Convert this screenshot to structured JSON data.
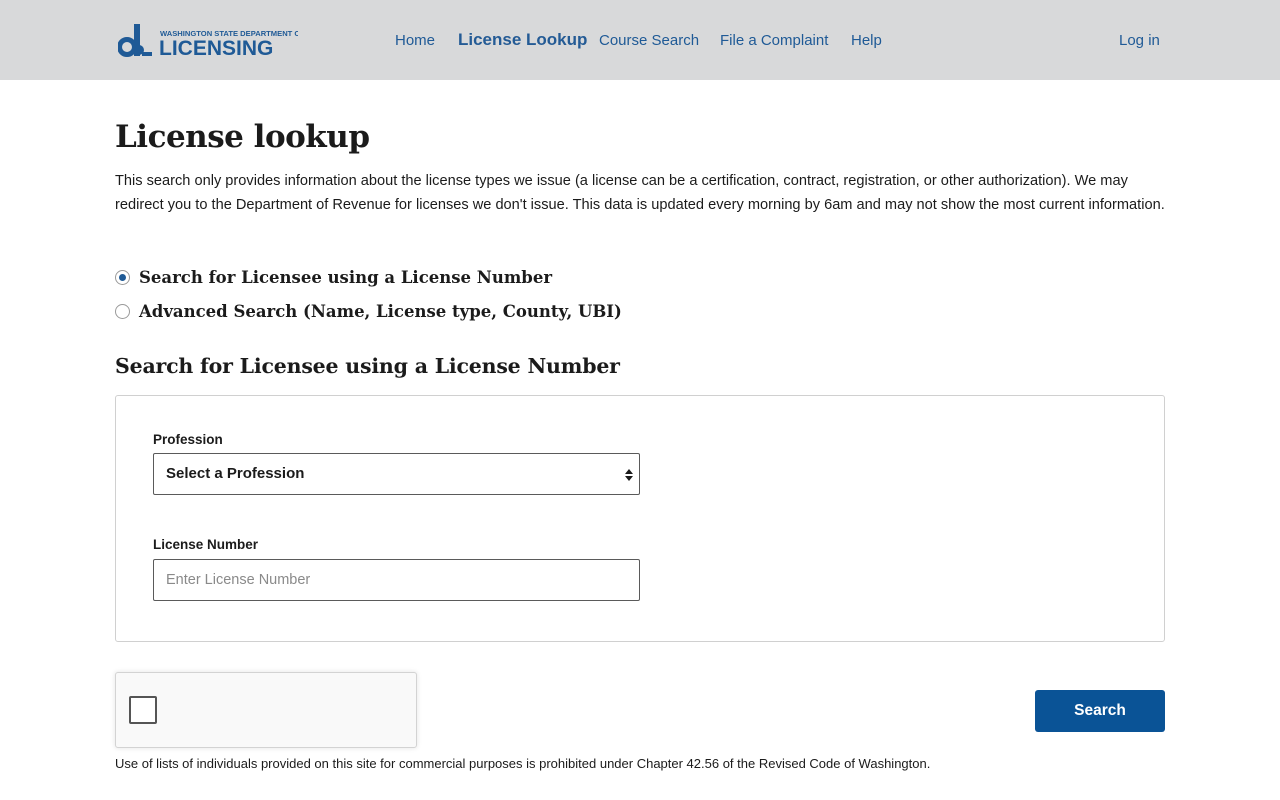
{
  "header": {
    "logo_top_text": "WASHINGTON STATE DEPARTMENT OF",
    "logo_main_text": "LICENSING",
    "nav": [
      "Home",
      "License Lookup",
      "Course Search",
      "File a Complaint",
      "Help"
    ],
    "active_nav": "License Lookup",
    "login": "Log in"
  },
  "page": {
    "title": "License lookup",
    "intro": "This search only provides information about the license types we issue (a license can be a certification, contract, registration, or other authorization). We may redirect you to the Department of Revenue for licenses we don't issue. This data is updated every morning by 6am and may not show the most current information."
  },
  "search_mode": {
    "options": [
      {
        "label": "Search for Licensee using a License Number",
        "checked": true
      },
      {
        "label": "Advanced Search (Name, License type, County, UBI)",
        "checked": false
      }
    ]
  },
  "form": {
    "heading": "Search for Licensee using a License Number",
    "profession_label": "Profession",
    "profession_selected": "Select a Profession",
    "license_number_label": "License Number",
    "license_number_value": "",
    "license_number_placeholder": "Enter License Number",
    "search_button": "Search"
  },
  "captcha": {
    "checked": false
  },
  "footer": {
    "note": "Use of lists of individuals provided on this site for commercial purposes is prohibited under Chapter 42.56 of the Revised Code of Washington."
  },
  "colors": {
    "header_bg": "#d8d9da",
    "link": "#1f5a96",
    "brand_blue": "#0a5396",
    "text": "#1b1b1b"
  }
}
